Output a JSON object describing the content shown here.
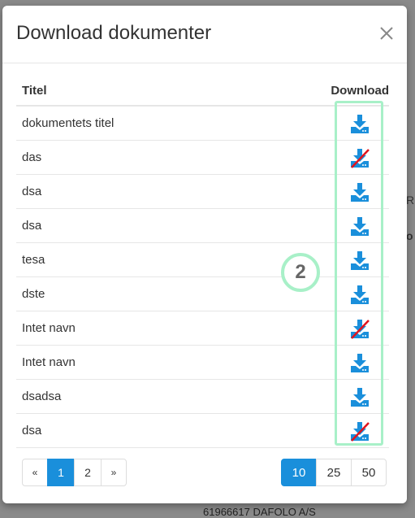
{
  "modal": {
    "title": "Download dokumenter",
    "close_icon": "close-icon"
  },
  "table": {
    "headers": {
      "title": "Titel",
      "download": "Download"
    },
    "rows": [
      {
        "title": "dokumentets titel",
        "available": true
      },
      {
        "title": "das",
        "available": false
      },
      {
        "title": "dsa",
        "available": true
      },
      {
        "title": "dsa",
        "available": true
      },
      {
        "title": "tesa",
        "available": true
      },
      {
        "title": "dste",
        "available": true
      },
      {
        "title": "Intet navn",
        "available": false
      },
      {
        "title": "Intet navn",
        "available": true
      },
      {
        "title": "dsadsa",
        "available": true
      },
      {
        "title": "dsa",
        "available": false
      }
    ]
  },
  "annotation": {
    "badge_number": "2",
    "highlight_color": "#a8f0c8"
  },
  "pagination": {
    "prev": "«",
    "pages": [
      "1",
      "2"
    ],
    "active_page": "1",
    "next": "»"
  },
  "page_size": {
    "options": [
      "10",
      "25",
      "50"
    ],
    "selected": "10"
  },
  "background": {
    "fragment_right_1": "R",
    "fragment_right_2": "o",
    "bottom_text": "61966617 DAFOLO A/S"
  },
  "colors": {
    "accent": "#1a8fdb",
    "disabled_slash": "#e0141e"
  }
}
